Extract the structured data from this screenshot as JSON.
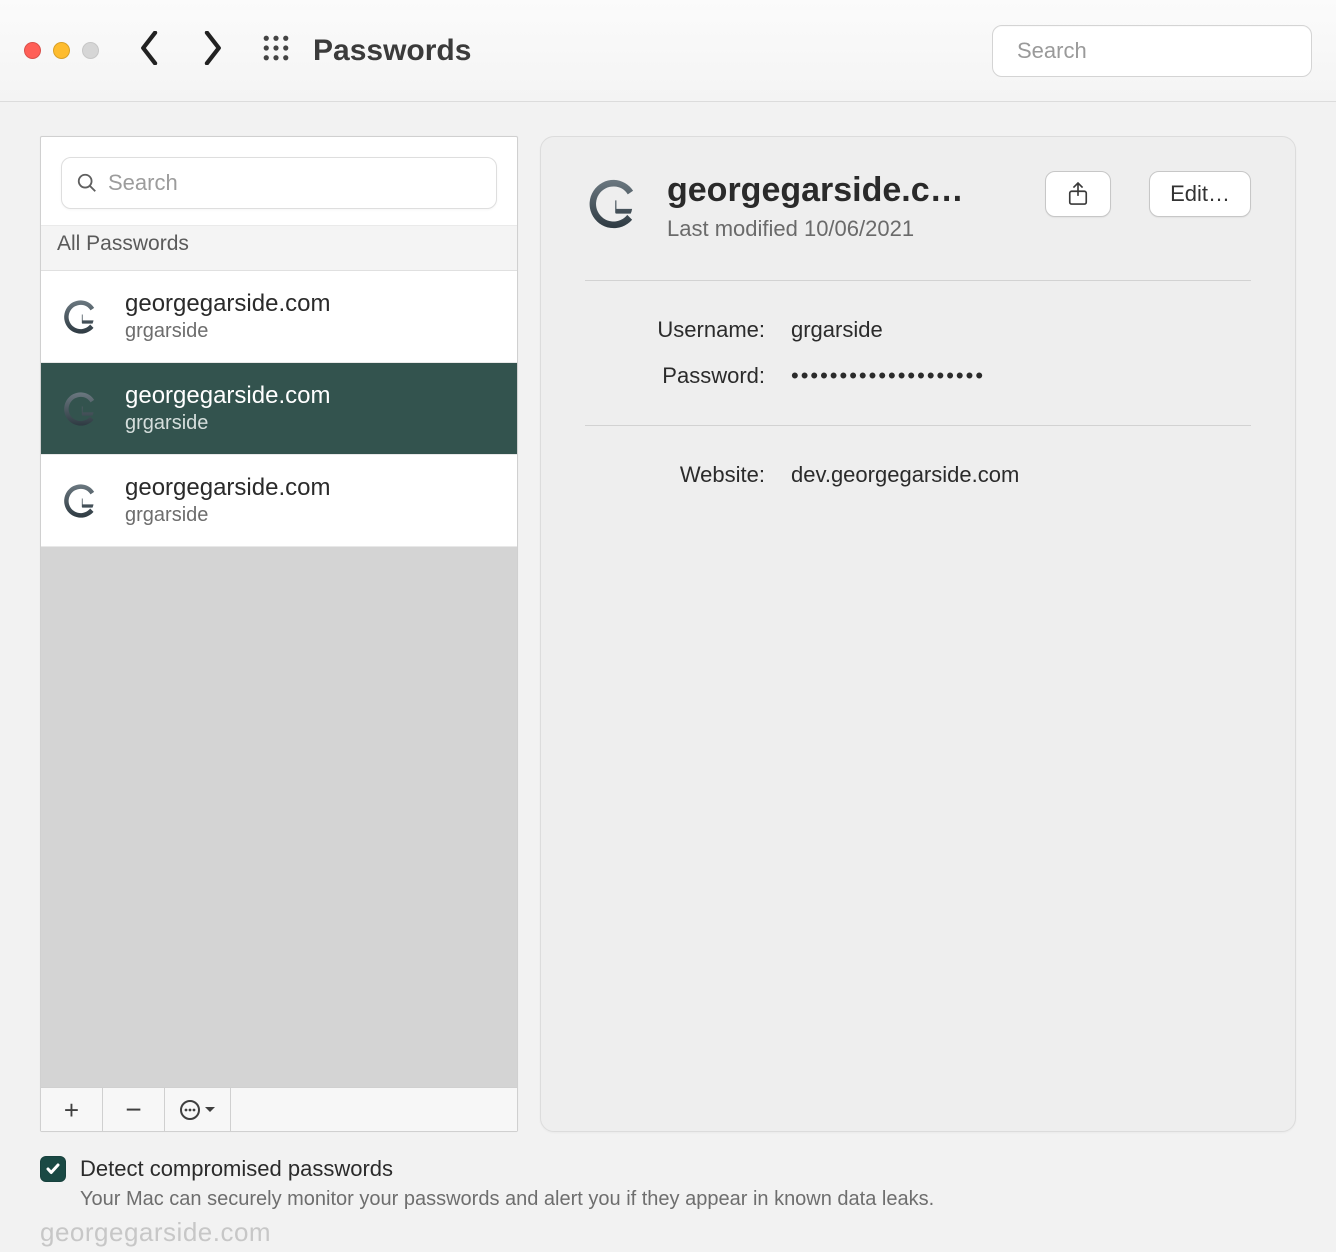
{
  "toolbar": {
    "title": "Passwords",
    "search_placeholder": "Search"
  },
  "sidebar": {
    "search_placeholder": "Search",
    "header_label": "All Passwords",
    "items": [
      {
        "site": "georgegarside.com",
        "user": "grgarside",
        "selected": false
      },
      {
        "site": "georgegarside.com",
        "user": "grgarside",
        "selected": true
      },
      {
        "site": "georgegarside.com",
        "user": "grgarside",
        "selected": false
      }
    ]
  },
  "detail": {
    "title": "georgegarside.c…",
    "last_modified_label": "Last modified 10/06/2021",
    "edit_label": "Edit…",
    "username_label": "Username:",
    "username_value": "grgarside",
    "password_label": "Password:",
    "password_masked": "••••••••••••••••••••",
    "website_label": "Website:",
    "website_value": "dev.georgegarside.com"
  },
  "options": {
    "detect_label": "Detect compromised passwords",
    "detect_desc": "Your Mac can securely monitor your passwords and alert you if they appear in known data leaks.",
    "detect_checked": true
  },
  "watermark": "georgegarside.com"
}
